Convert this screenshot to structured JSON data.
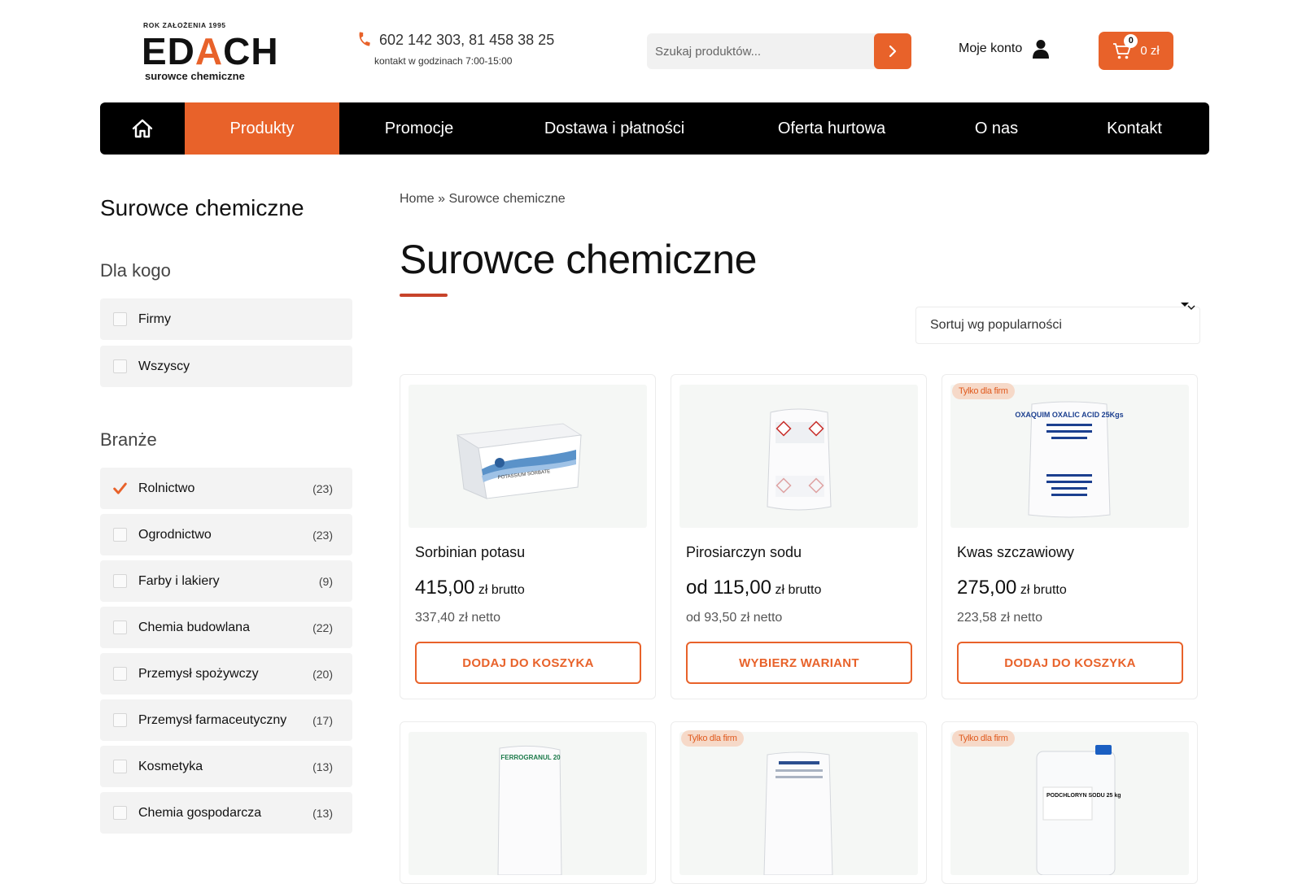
{
  "brand": {
    "founded": "ROK ZAŁOŻENIA 1995",
    "name_part1": "ED",
    "name_accent": "A",
    "name_part2": "CH",
    "tagline": "surowce chemiczne",
    "accent_color": "#e8622a"
  },
  "contact": {
    "phones": "602 142 303, 81 458 38 25",
    "hours": "kontakt w godzinach 7:00-15:00"
  },
  "search": {
    "placeholder": "Szukaj produktów..."
  },
  "account": {
    "label": "Moje konto"
  },
  "cart": {
    "count": "0",
    "total": "0 zł"
  },
  "nav": {
    "items": [
      "Produkty",
      "Promocje",
      "Dostawa i płatności",
      "Oferta hurtowa",
      "O nas",
      "Kontakt"
    ],
    "active": "Produkty"
  },
  "sidebar": {
    "title": "Surowce chemiczne",
    "dla_kogo": {
      "heading": "Dla kogo",
      "items": [
        {
          "label": "Firmy",
          "checked": false
        },
        {
          "label": "Wszyscy",
          "checked": false
        }
      ]
    },
    "branze": {
      "heading": "Branże",
      "items": [
        {
          "label": "Rolnictwo",
          "count": "(23)",
          "checked": true
        },
        {
          "label": "Ogrodnictwo",
          "count": "(23)",
          "checked": false
        },
        {
          "label": "Farby i lakiery",
          "count": "(9)",
          "checked": false
        },
        {
          "label": "Chemia budowlana",
          "count": "(22)",
          "checked": false
        },
        {
          "label": "Przemysł spożywczy",
          "count": "(20)",
          "checked": false
        },
        {
          "label": "Przemysł farmaceutyczny",
          "count": "(17)",
          "checked": false
        },
        {
          "label": "Kosmetyka",
          "count": "(13)",
          "checked": false
        },
        {
          "label": "Chemia gospodarcza",
          "count": "(13)",
          "checked": false
        }
      ]
    }
  },
  "breadcrumb": {
    "home": "Home",
    "separator": "»",
    "current": "Surowce chemiczne"
  },
  "page_title": "Surowce chemiczne",
  "sort": {
    "selected": "Sortuj wg popularności"
  },
  "products": [
    {
      "name": "Sorbinian potasu",
      "price": "415,00",
      "price_suffix": "zł brutto",
      "netto": "337,40 zł netto",
      "button": "DODAJ DO KOSZYKA",
      "badge": "",
      "image_text": "POTASSIUM SORBATE"
    },
    {
      "name": "Pirosiarczyn sodu",
      "price": "od 115,00",
      "price_suffix": "zł brutto",
      "netto": "od 93,50 zł netto",
      "button": "WYBIERZ WARIANT",
      "badge": "",
      "image_text": ""
    },
    {
      "name": "Kwas szczawiowy",
      "price": "275,00",
      "price_suffix": "zł brutto",
      "netto": "223,58 zł netto",
      "button": "DODAJ DO KOSZYKA",
      "badge": "Tylko dla firm",
      "image_text": "OXAQUIM OXALIC ACID 25Kgs"
    },
    {
      "badge": "",
      "image_text": "FERROGRANUL 20"
    },
    {
      "badge": "Tylko dla firm",
      "image_text": ""
    },
    {
      "badge": "Tylko dla firm",
      "image_text": "PODCHLORYN SODU 25 kg"
    }
  ]
}
